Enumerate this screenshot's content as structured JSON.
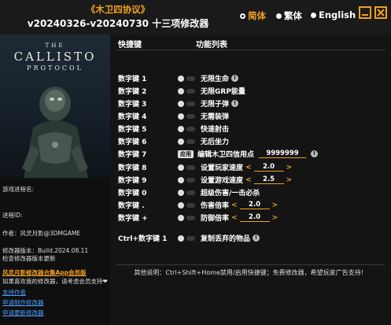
{
  "header": {
    "title": "《木卫四协议》",
    "subtitle": "v20240326-v20240730 十三项修改器",
    "lang_simplified": "简体",
    "lang_traditional": "繁体",
    "lang_english": "English",
    "accent_color": "#f0a020"
  },
  "cover": {
    "the": "THE",
    "callisto": "CALLISTO",
    "protocol": "PROTOCOL"
  },
  "left": {
    "process_name_label": "游戏进程名:",
    "process_id_label": "进程ID:",
    "author": "作者：风灵月影@3DMGAME",
    "version": "修改器版本：Build.2024.08.11",
    "check_update": "检查修改器版本更新",
    "app_promo": "风灵月影修改器合集App会员版",
    "like_text": "如果喜欢我的修改器，请考虑会员支持❤",
    "support_link": "支持作者",
    "request_link": "申请制作修改器",
    "update_link": "申请更新修改器"
  },
  "columns": {
    "hotkey": "快捷键",
    "features": "功能列表"
  },
  "rows": [
    {
      "key": "数字键 1",
      "name": "无限生命",
      "info": "!"
    },
    {
      "key": "数字键 2",
      "name": "无限GRP能量"
    },
    {
      "key": "数字键 3",
      "name": "无限子弹",
      "info": "!"
    },
    {
      "key": "数字键 4",
      "name": "无需装弹"
    },
    {
      "key": "数字键 5",
      "name": "快速射击"
    },
    {
      "key": "数字键 6",
      "name": "无后坐力"
    },
    {
      "key": "数字键 7",
      "name": "编辑木卫四信用点",
      "apply": "应用",
      "value": "9999999",
      "info": "!"
    },
    {
      "key": "数字键 8",
      "name": "设置玩家速度",
      "value": "2.0"
    },
    {
      "key": "数字键 9",
      "name": "设置游戏速度",
      "value": "2.5"
    },
    {
      "key": "数字键 0",
      "name": "超级伤害/一击必杀"
    },
    {
      "key": "数字键 .",
      "name": "伤害倍率",
      "value": "2.0"
    },
    {
      "key": "数字键 +",
      "name": "防御倍率",
      "value": "2.0"
    },
    {
      "key": "Ctrl+数字键 1",
      "name": "复制丢弃的物品",
      "info": "!"
    }
  ],
  "footer": "其他说明：Ctrl+Shift+Home禁用/启用快捷键；免费修改器，希望玩家广告支持！"
}
